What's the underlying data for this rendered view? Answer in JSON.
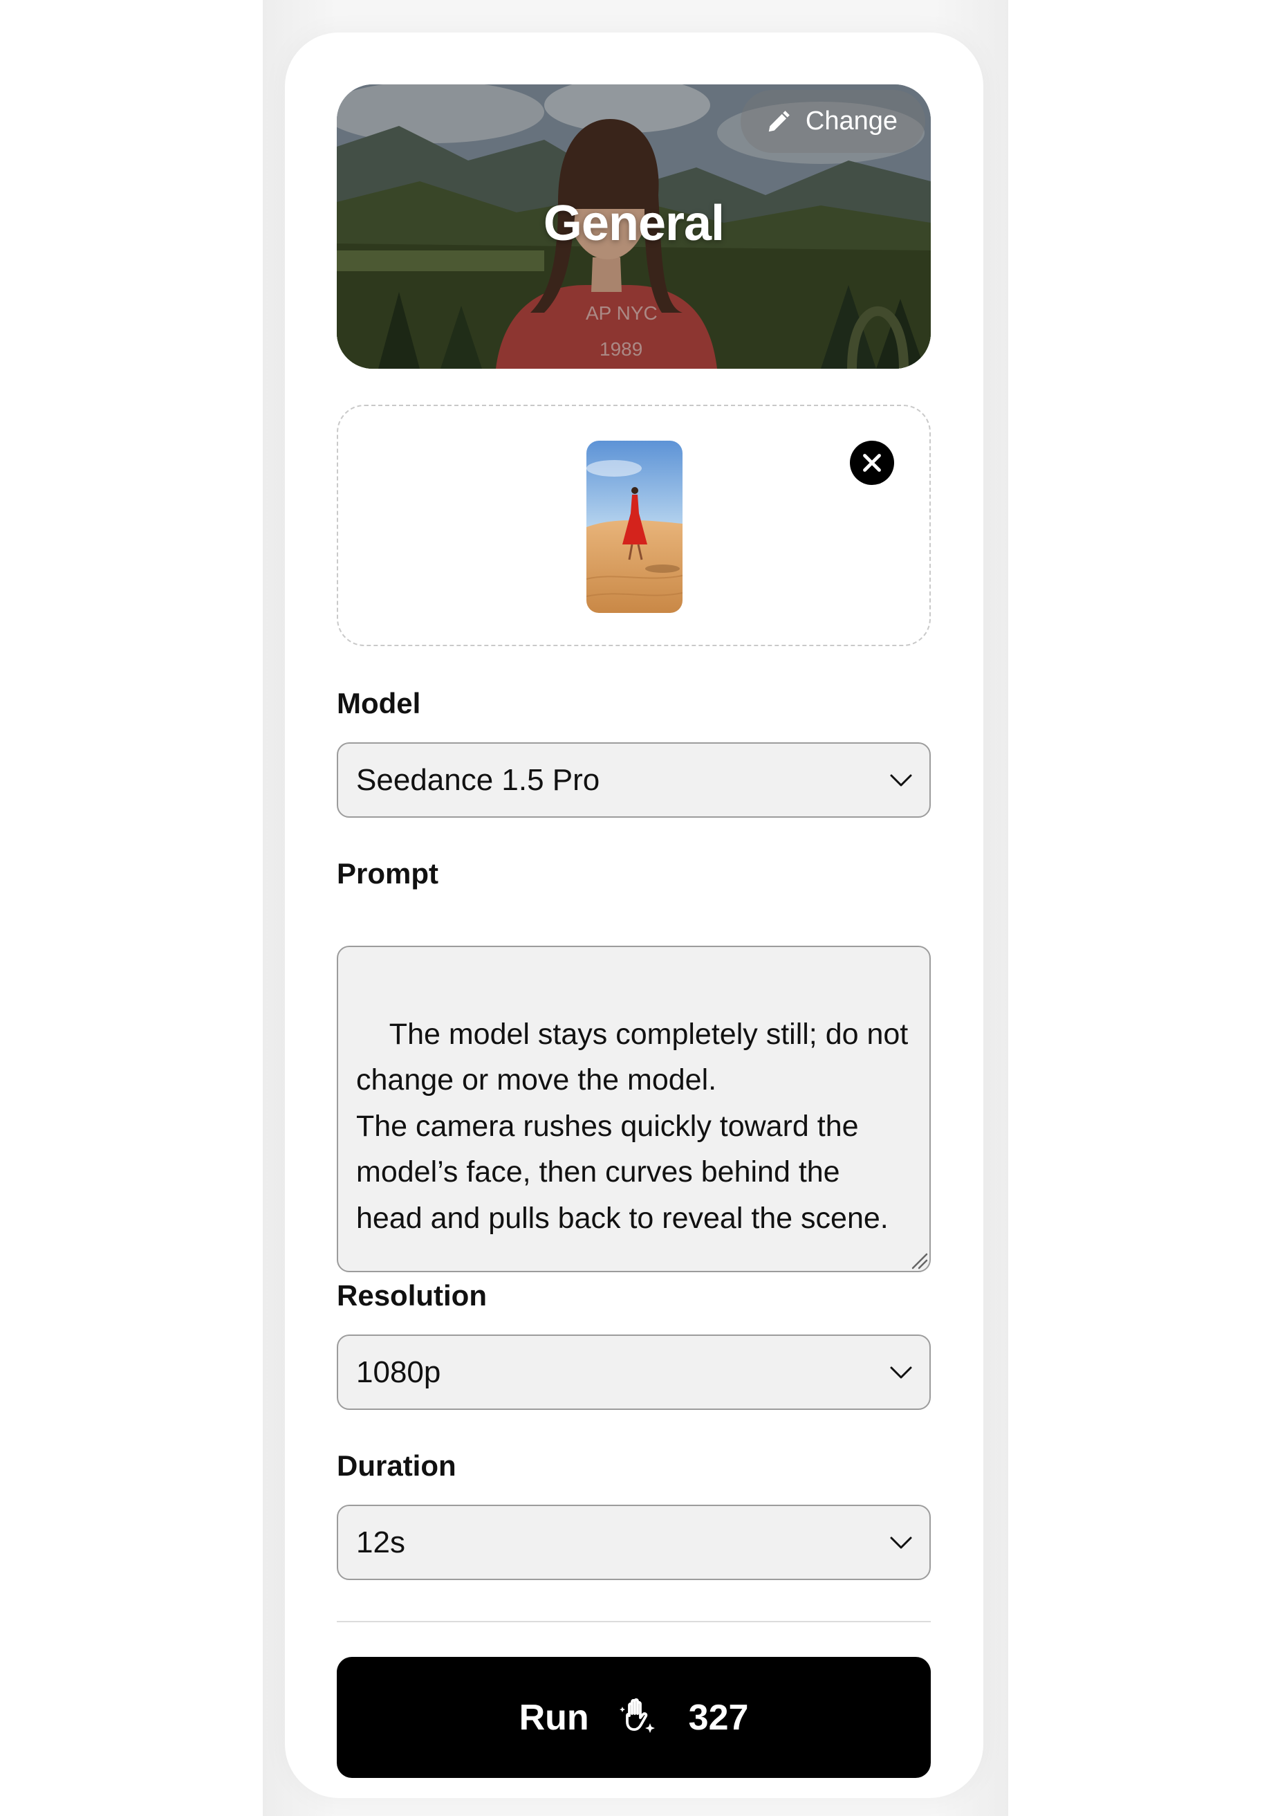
{
  "hero": {
    "title": "General",
    "change_label": "Change",
    "change_icon": "pencil-icon"
  },
  "upload": {
    "thumbnail_alt": "Woman in red dress walking on sand dunes",
    "remove_icon": "close-icon"
  },
  "form": {
    "model": {
      "label": "Model",
      "value": "Seedance 1.5 Pro"
    },
    "prompt": {
      "label": "Prompt",
      "value": "The model stays completely still; do not change or move the model.\nThe camera rushes quickly toward the model’s face, then curves behind the head and pulls back to reveal the scene."
    },
    "resolution": {
      "label": "Resolution",
      "value": "1080p"
    },
    "duration": {
      "label": "Duration",
      "value": "12s"
    }
  },
  "run": {
    "label": "Run",
    "credit_icon": "hand-sparkle-icon",
    "cost": "327"
  },
  "colors": {
    "accent": "#000000",
    "field_bg": "#f1f1f1",
    "field_border": "#9c9c9c"
  }
}
